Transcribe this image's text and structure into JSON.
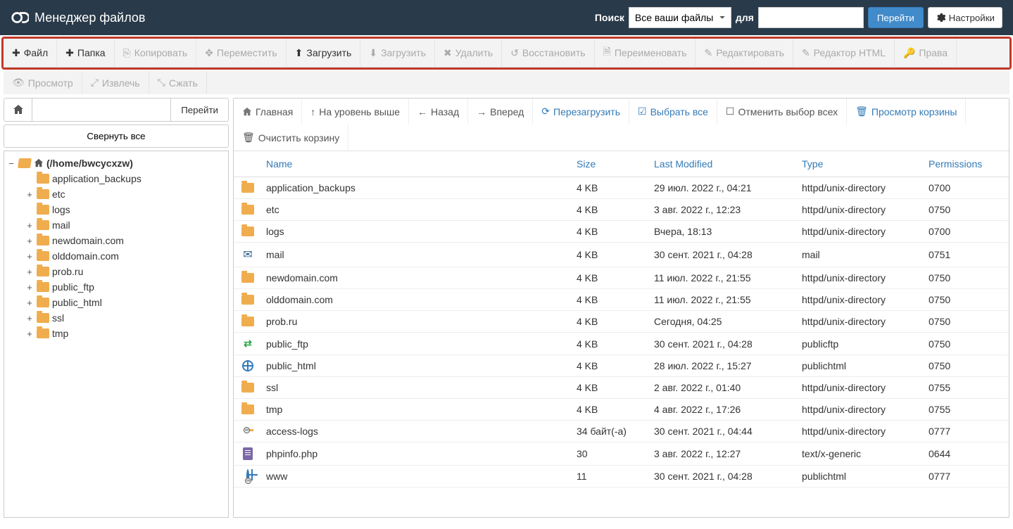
{
  "header": {
    "app_title": "Менеджер файлов",
    "search_label": "Поиск",
    "search_select": "Все ваши файлы",
    "for_label": "для",
    "go_button": "Перейти",
    "settings_button": "Настройки"
  },
  "toolbar": {
    "file": "Файл",
    "folder": "Папка",
    "copy": "Копировать",
    "move": "Переместить",
    "upload": "Загрузить",
    "download": "Загрузить",
    "delete": "Удалить",
    "restore": "Восстановить",
    "rename": "Переименовать",
    "edit": "Редактировать",
    "html_editor": "Редактор HTML",
    "permissions": "Права",
    "view": "Просмотр",
    "extract": "Извлечь",
    "compress": "Сжать"
  },
  "sidebar": {
    "path_value": "",
    "go_button": "Перейти",
    "collapse_all": "Свернуть все",
    "root": "(/home/bwcycxzw)",
    "items": [
      {
        "label": "application_backups",
        "expandable": false
      },
      {
        "label": "etc",
        "expandable": true
      },
      {
        "label": "logs",
        "expandable": false
      },
      {
        "label": "mail",
        "expandable": true
      },
      {
        "label": "newdomain.com",
        "expandable": true
      },
      {
        "label": "olddomain.com",
        "expandable": true
      },
      {
        "label": "prob.ru",
        "expandable": true
      },
      {
        "label": "public_ftp",
        "expandable": true
      },
      {
        "label": "public_html",
        "expandable": true
      },
      {
        "label": "ssl",
        "expandable": true
      },
      {
        "label": "tmp",
        "expandable": true
      }
    ]
  },
  "nav": {
    "home": "Главная",
    "up": "На уровень выше",
    "back": "Назад",
    "forward": "Вперед",
    "reload": "Перезагрузить",
    "select_all": "Выбрать все",
    "deselect_all": "Отменить выбор всех",
    "view_trash": "Просмотр корзины",
    "empty_trash": "Очистить корзину"
  },
  "table": {
    "headers": {
      "name": "Name",
      "size": "Size",
      "modified": "Last Modified",
      "type": "Type",
      "permissions": "Permissions"
    },
    "rows": [
      {
        "icon": "folder",
        "name": "application_backups",
        "size": "4 KB",
        "modified": "29 июл. 2022 г., 04:21",
        "type": "httpd/unix-directory",
        "perm": "0700"
      },
      {
        "icon": "folder",
        "name": "etc",
        "size": "4 KB",
        "modified": "3 авг. 2022 г., 12:23",
        "type": "httpd/unix-directory",
        "perm": "0750"
      },
      {
        "icon": "folder",
        "name": "logs",
        "size": "4 KB",
        "modified": "Вчера, 18:13",
        "type": "httpd/unix-directory",
        "perm": "0700"
      },
      {
        "icon": "mail",
        "name": "mail",
        "size": "4 KB",
        "modified": "30 сент. 2021 г., 04:28",
        "type": "mail",
        "perm": "0751"
      },
      {
        "icon": "folder",
        "name": "newdomain.com",
        "size": "4 KB",
        "modified": "11 июл. 2022 г., 21:55",
        "type": "httpd/unix-directory",
        "perm": "0750"
      },
      {
        "icon": "folder",
        "name": "olddomain.com",
        "size": "4 KB",
        "modified": "11 июл. 2022 г., 21:55",
        "type": "httpd/unix-directory",
        "perm": "0750"
      },
      {
        "icon": "folder",
        "name": "prob.ru",
        "size": "4 KB",
        "modified": "Сегодня, 04:25",
        "type": "httpd/unix-directory",
        "perm": "0750"
      },
      {
        "icon": "ftp",
        "name": "public_ftp",
        "size": "4 KB",
        "modified": "30 сент. 2021 г., 04:28",
        "type": "publicftp",
        "perm": "0750"
      },
      {
        "icon": "globe",
        "name": "public_html",
        "size": "4 KB",
        "modified": "28 июл. 2022 г., 15:27",
        "type": "publichtml",
        "perm": "0750"
      },
      {
        "icon": "folder",
        "name": "ssl",
        "size": "4 KB",
        "modified": "2 авг. 2022 г., 01:40",
        "type": "httpd/unix-directory",
        "perm": "0755"
      },
      {
        "icon": "folder",
        "name": "tmp",
        "size": "4 KB",
        "modified": "4 авг. 2022 г., 17:26",
        "type": "httpd/unix-directory",
        "perm": "0755"
      },
      {
        "icon": "folder-link",
        "name": "access-logs",
        "size": "34 байт(-а)",
        "modified": "30 сент. 2021 г., 04:44",
        "type": "httpd/unix-directory",
        "perm": "0777"
      },
      {
        "icon": "file",
        "name": "phpinfo.php",
        "size": "30",
        "modified": "3 авг. 2022 г., 12:27",
        "type": "text/x-generic",
        "perm": "0644"
      },
      {
        "icon": "globe-link",
        "name": "www",
        "size": "11",
        "modified": "30 сент. 2021 г., 04:28",
        "type": "publichtml",
        "perm": "0777"
      }
    ]
  }
}
